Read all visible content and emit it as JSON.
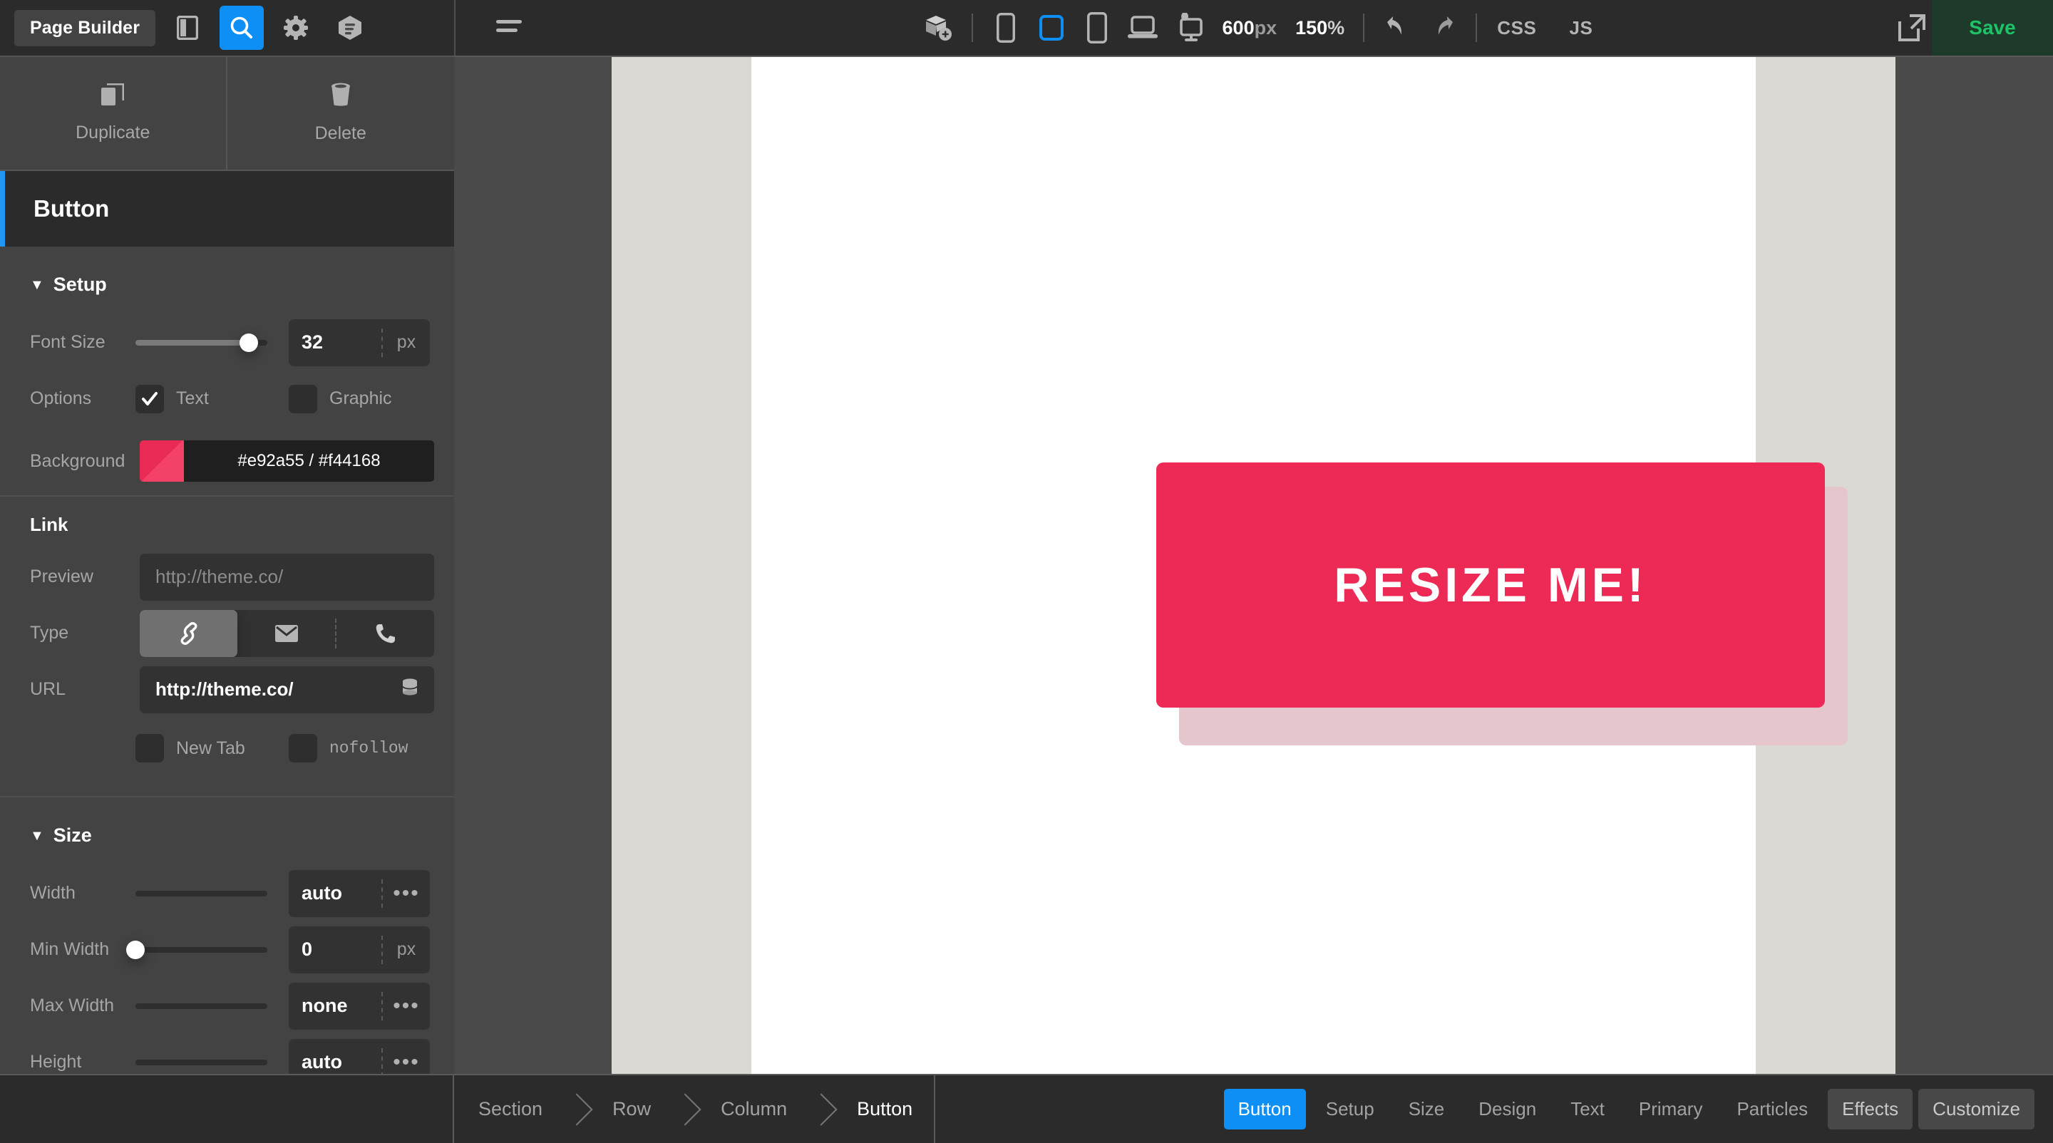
{
  "topbar": {
    "brand": "Page Builder",
    "icons": [
      {
        "name": "sidebar-toggle-icon",
        "label": "sidebar-toggle"
      },
      {
        "name": "search-icon",
        "label": "search",
        "active": true
      },
      {
        "name": "gear-icon",
        "label": "settings"
      },
      {
        "name": "layers-hexagon-icon",
        "label": "layers"
      }
    ],
    "menu_icon": "hamburger-menu-icon",
    "add_block_icon": "add-block-icon",
    "devices": [
      {
        "name": "device-mobile-portrait",
        "active": false
      },
      {
        "name": "device-mobile-landscape",
        "active": true
      },
      {
        "name": "device-tablet",
        "active": false
      },
      {
        "name": "device-laptop",
        "active": false
      },
      {
        "name": "device-desktop",
        "active": false
      }
    ],
    "viewport_width": "600",
    "viewport_unit": "px",
    "zoom_value": "150",
    "zoom_unit": "%",
    "undo_icon": "undo-arrow-icon",
    "redo_icon": "redo-arrow-icon",
    "css_label": "CSS",
    "js_label": "JS",
    "export_icon": "external-link-icon",
    "save_label": "Save"
  },
  "sidebar": {
    "duplicate_label": "Duplicate",
    "duplicate_icon": "duplicate-icon",
    "delete_label": "Delete",
    "delete_icon": "trash-icon",
    "element_title": "Button",
    "setup": {
      "title": "Setup",
      "font_size_label": "Font Size",
      "font_size_value": "32",
      "font_size_unit": "px",
      "font_size_percent": 86,
      "options_label": "Options",
      "option_text_label": "Text",
      "option_text_checked": true,
      "option_graphic_label": "Graphic",
      "option_graphic_checked": false,
      "background_label": "Background",
      "background_value": "#e92a55 / #f44168",
      "background_color_1": "#e92a55",
      "background_color_2": "#f44168"
    },
    "link": {
      "title": "Link",
      "preview_label": "Preview",
      "preview_placeholder": "http://theme.co/",
      "type_label": "Type",
      "type_options": [
        {
          "name": "link-icon",
          "selected": true
        },
        {
          "name": "email-icon",
          "selected": false
        },
        {
          "name": "phone-icon",
          "selected": false
        }
      ],
      "url_label": "URL",
      "url_value": "http://theme.co/",
      "url_icon": "database-icon",
      "new_tab_label": "New Tab",
      "new_tab_checked": false,
      "nofollow_label": "nofollow",
      "nofollow_checked": false
    },
    "size": {
      "title": "Size",
      "rows": [
        {
          "label": "Width",
          "value": "auto",
          "unit": "dots",
          "percent": 0,
          "thumb": false
        },
        {
          "label": "Min Width",
          "value": "0",
          "unit": "px",
          "percent": 0,
          "thumb": true
        },
        {
          "label": "Max Width",
          "value": "none",
          "unit": "dots",
          "percent": 0,
          "thumb": false
        },
        {
          "label": "Height",
          "value": "auto",
          "unit": "dots",
          "percent": 0,
          "thumb": false
        }
      ]
    }
  },
  "canvas": {
    "button_text": "RESIZE ME!",
    "button_color": "#ed2a55",
    "button_shadow_color": "#e5c6cc"
  },
  "bottombar": {
    "breadcrumb": [
      {
        "label": "Section",
        "active": false
      },
      {
        "label": "Row",
        "active": false
      },
      {
        "label": "Column",
        "active": false
      },
      {
        "label": "Button",
        "active": true
      }
    ],
    "tabs": [
      {
        "label": "Button",
        "style": "blue"
      },
      {
        "label": "Setup",
        "style": "plain"
      },
      {
        "label": "Size",
        "style": "plain"
      },
      {
        "label": "Design",
        "style": "plain"
      },
      {
        "label": "Text",
        "style": "plain"
      },
      {
        "label": "Primary",
        "style": "plain"
      },
      {
        "label": "Particles",
        "style": "plain"
      },
      {
        "label": "Effects",
        "style": "gray"
      },
      {
        "label": "Customize",
        "style": "gray"
      }
    ]
  }
}
